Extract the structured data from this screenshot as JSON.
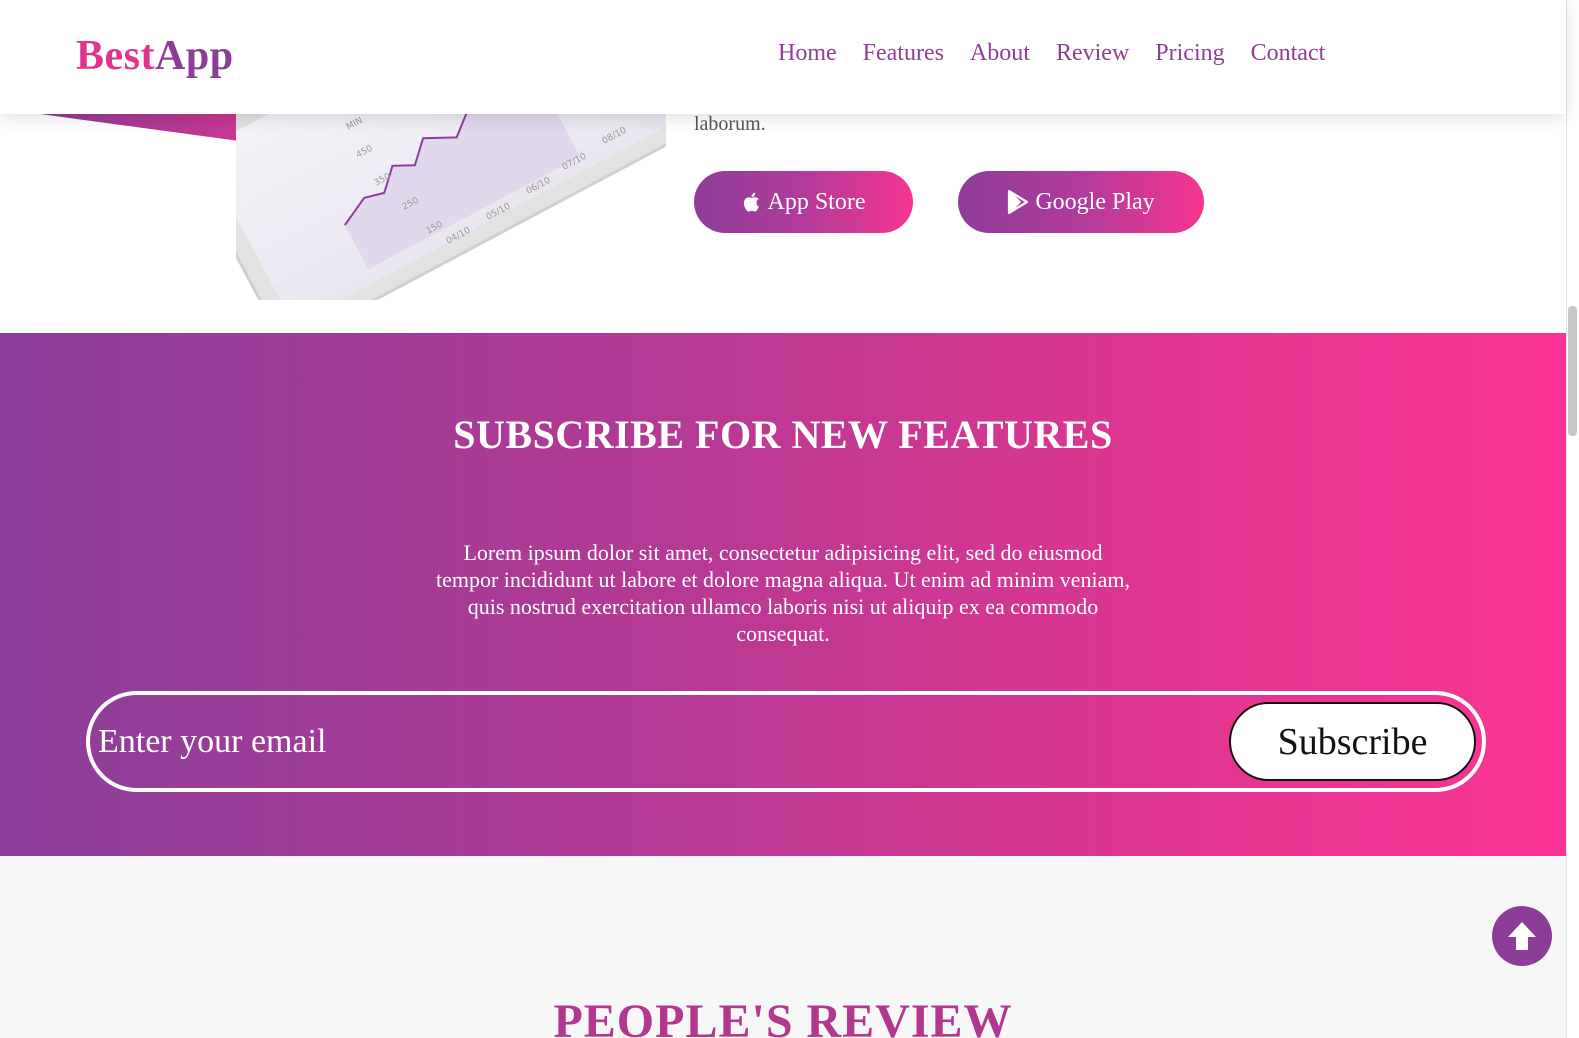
{
  "brand": {
    "part1": "Best",
    "part2": "App"
  },
  "nav": {
    "items": [
      {
        "label": "Home"
      },
      {
        "label": "Features"
      },
      {
        "label": "About"
      },
      {
        "label": "Review"
      },
      {
        "label": "Pricing"
      },
      {
        "label": "Contact"
      }
    ]
  },
  "hero": {
    "text_tail": "laborum.",
    "app_store_label": "App Store",
    "google_play_label": "Google Play",
    "chart_axis_labels": [
      "MIN",
      "450",
      "350",
      "250",
      "150",
      "04/10",
      "05/10",
      "06/10",
      "07/10",
      "08/10"
    ]
  },
  "subscribe": {
    "title": "SUBSCRIBE FOR NEW FEATURES",
    "text": "Lorem ipsum dolor sit amet, consectetur adipisicing elit, sed do eiusmod tempor incididunt ut labore et dolore magna aliqua. Ut enim ad minim veniam, quis nostrud exercitation ullamco laboris nisi ut aliquip ex ea commodo consequat.",
    "email_placeholder": "Enter your email",
    "button_label": "Subscribe"
  },
  "review": {
    "title": "PEOPLE'S REVIEW"
  },
  "colors": {
    "brand_pink": "#e0358f",
    "brand_purple": "#8c3d97",
    "gradient_start": "#8b3f99",
    "gradient_end": "#fb3394"
  },
  "icons": {
    "app_store": "apple-icon",
    "google_play": "play-icon",
    "back_to_top": "arrow-up-circle-icon"
  }
}
